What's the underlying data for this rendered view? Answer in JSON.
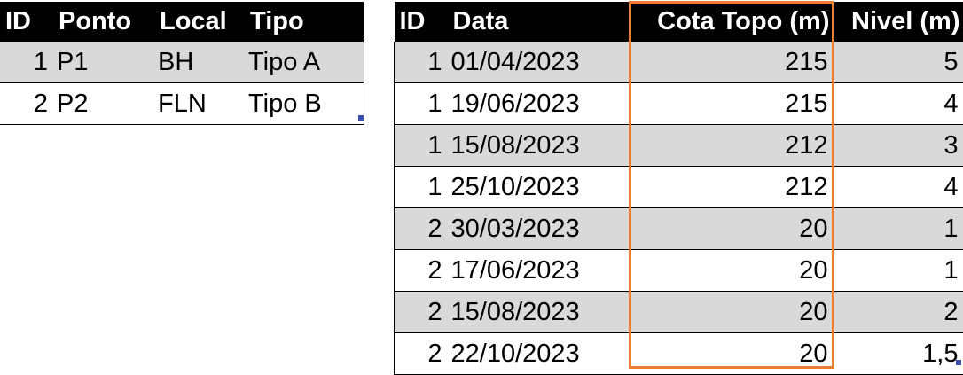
{
  "table1": {
    "headers": [
      "ID",
      "Ponto",
      "Local",
      "Tipo"
    ],
    "rows": [
      [
        "1",
        "P1",
        "BH",
        "Tipo A"
      ],
      [
        "2",
        "P2",
        "FLN",
        "Tipo B"
      ]
    ]
  },
  "table2": {
    "headers": [
      "ID",
      "Data",
      "Cota Topo (m)",
      "Nivel (m)"
    ],
    "rows": [
      [
        "1",
        "01/04/2023",
        "215",
        "5"
      ],
      [
        "1",
        "19/06/2023",
        "215",
        "4"
      ],
      [
        "1",
        "15/08/2023",
        "212",
        "3"
      ],
      [
        "1",
        "25/10/2023",
        "212",
        "4"
      ],
      [
        "2",
        "30/03/2023",
        "20",
        "1"
      ],
      [
        "2",
        "17/06/2023",
        "20",
        "1"
      ],
      [
        "2",
        "15/08/2023",
        "20",
        "2"
      ],
      [
        "2",
        "22/10/2023",
        "20",
        "1,5"
      ]
    ]
  },
  "colors": {
    "header_bg": "#000000",
    "header_fg": "#ffffff",
    "band_row": "#d9d9d9",
    "highlight_border": "#ed7d31",
    "resize_handle": "#3a4fb0"
  }
}
